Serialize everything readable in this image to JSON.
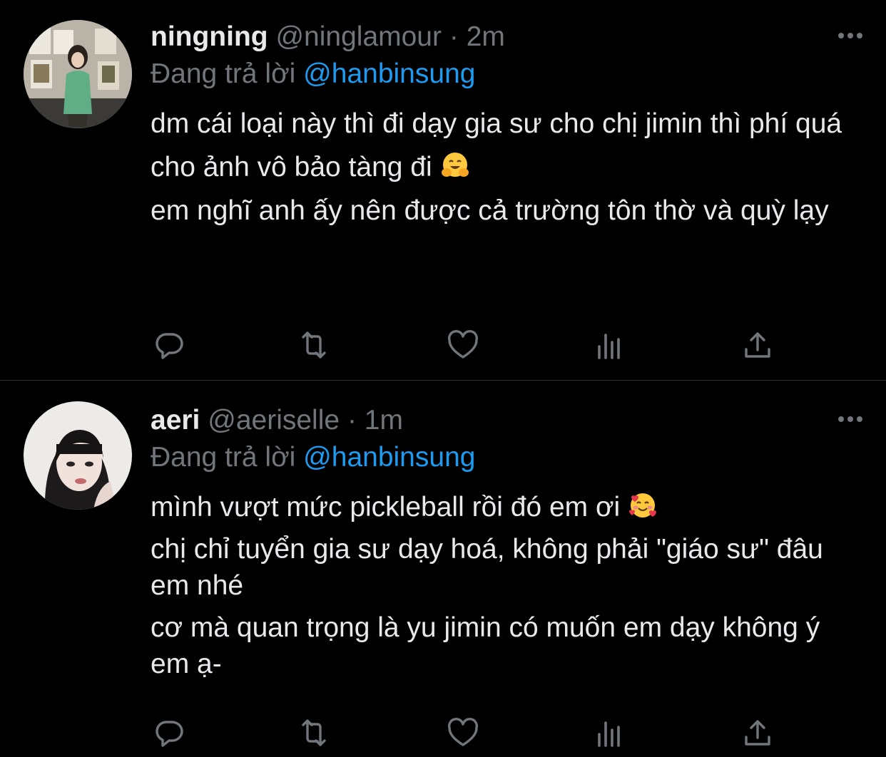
{
  "colors": {
    "background": "#000000",
    "text": "#e7e9ea",
    "muted": "#71767b",
    "accent": "#1d9bf0",
    "divider": "#2f3336"
  },
  "tweets": [
    {
      "display_name": "ningning",
      "handle": "@ninglamour",
      "separator": "·",
      "time": "2m",
      "replying_prefix": "Đang trả lời",
      "replying_to": "@hanbinsung",
      "paragraphs": [
        "dm cái loại này thì đi dạy gia sư cho chị jimin thì phí quá",
        "cho ảnh vô bảo tàng đi",
        "em nghĩ anh ấy nên được cả trường tôn thờ và quỳ lạy"
      ],
      "emoji_after_paragraph_2": "hugging-face-emoji",
      "actions": [
        "reply-icon",
        "retweet-icon",
        "like-icon",
        "analytics-icon",
        "share-icon"
      ]
    },
    {
      "display_name": "aeri",
      "handle": "@aeriselle",
      "separator": "·",
      "time": "1m",
      "replying_prefix": "Đang trả lời",
      "replying_to": "@hanbinsung",
      "paragraphs": [
        "mình vượt mức pickleball rồi đó em ơi",
        "chị chỉ tuyển gia sư dạy hoá, không phải \"giáo sư\" đâu em nhé",
        "cơ mà quan trọng là yu jimin có muốn em dạy không ý em ạ-"
      ],
      "emoji_after_paragraph_1": "smiling-face-with-hearts-emoji",
      "actions": [
        "reply-icon",
        "retweet-icon",
        "like-icon",
        "analytics-icon",
        "share-icon"
      ]
    }
  ]
}
